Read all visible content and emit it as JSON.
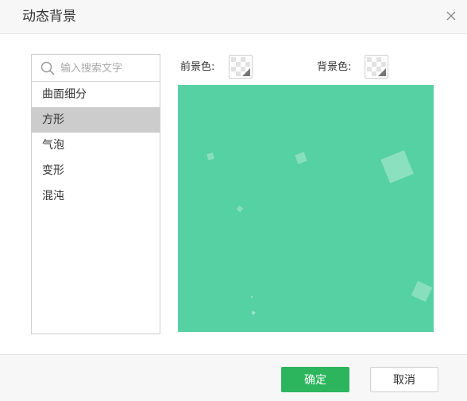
{
  "dialog": {
    "title": "动态背景"
  },
  "search": {
    "placeholder": "输入搜索文字"
  },
  "list": {
    "items": [
      {
        "label": "曲面细分",
        "selected": false
      },
      {
        "label": "方形",
        "selected": true
      },
      {
        "label": "气泡",
        "selected": false
      },
      {
        "label": "变形",
        "selected": false
      },
      {
        "label": "混沌",
        "selected": false
      }
    ]
  },
  "colors": {
    "foreground_label": "前景色:",
    "background_label": "背景色:",
    "preview_background": "#55d1a3",
    "shape_fill": "#ffffff",
    "accent": "#2db55d"
  },
  "footer": {
    "ok_label": "确定",
    "cancel_label": "取消"
  }
}
